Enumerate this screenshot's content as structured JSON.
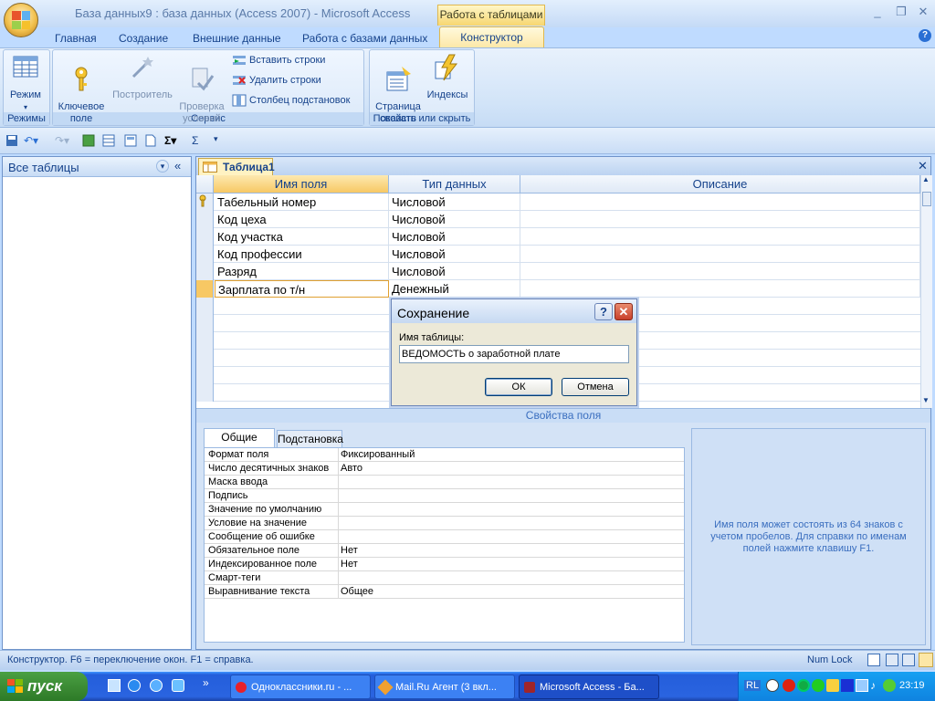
{
  "window": {
    "title": "База данных9 : база данных (Access 2007) - Microsoft Access",
    "context_tab_group": "Работа с таблицами"
  },
  "ribbon": {
    "tabs": [
      "Главная",
      "Создание",
      "Внешние данные",
      "Работа с базами данных",
      "Конструктор"
    ],
    "active_tab": "Конструктор",
    "groups": {
      "modes": {
        "label": "Режимы",
        "view_button": "Режим"
      },
      "service": {
        "label": "Сервис",
        "key_field": "Ключевое\nполе",
        "builder": "Построитель",
        "test_rules": "Проверка\nусловий",
        "insert_rows": "Вставить строки",
        "delete_rows": "Удалить строки",
        "lookup_column": "Столбец  подстановок"
      },
      "show_hide": {
        "label": "Показать или скрыть",
        "property_sheet": "Страница\nсвойств",
        "indexes": "Индексы"
      }
    }
  },
  "nav_pane": {
    "title": "Все таблицы"
  },
  "document": {
    "tab_label": "Таблица1",
    "columns": [
      "Имя поля",
      "Тип данных",
      "Описание"
    ],
    "rows": [
      {
        "name": "Табельный номер",
        "type": "Числовой",
        "key": true
      },
      {
        "name": "Код цеха",
        "type": "Числовой",
        "key": false
      },
      {
        "name": "Код участка",
        "type": "Числовой",
        "key": false
      },
      {
        "name": "Код профессии",
        "type": "Числовой",
        "key": false
      },
      {
        "name": "Разряд",
        "type": "Числовой",
        "key": false
      },
      {
        "name": "Зарплата по т/н",
        "type": "Денежный",
        "key": false
      }
    ]
  },
  "field_properties": {
    "title": "Свойства поля",
    "tabs": [
      "Общие",
      "Подстановка"
    ],
    "rows": [
      {
        "key": "Формат поля",
        "value": "Фиксированный"
      },
      {
        "key": "Число десятичных знаков",
        "value": "Авто"
      },
      {
        "key": "Маска ввода",
        "value": ""
      },
      {
        "key": "Подпись",
        "value": ""
      },
      {
        "key": "Значение по умолчанию",
        "value": ""
      },
      {
        "key": "Условие на значение",
        "value": ""
      },
      {
        "key": "Сообщение об ошибке",
        "value": ""
      },
      {
        "key": "Обязательное поле",
        "value": "Нет"
      },
      {
        "key": "Индексированное поле",
        "value": "Нет"
      },
      {
        "key": "Смарт-теги",
        "value": ""
      },
      {
        "key": "Выравнивание текста",
        "value": "Общее"
      }
    ],
    "hint": "Имя поля может состоять из 64 знаков с учетом пробелов.  Для справки по именам полей нажмите клавишу F1."
  },
  "dialog": {
    "title": "Сохранение",
    "label": "Имя таблицы:",
    "value": "ВЕДОМОСТЬ о заработной плате",
    "ok": "ОК",
    "cancel": "Отмена"
  },
  "status": {
    "text": "Конструктор.  F6 = переключение окон.  F1 = справка.",
    "numlock": "Num Lock"
  },
  "taskbar": {
    "start": "пуск",
    "tasks": [
      "Одноклассники.ru - ...",
      "Mail.Ru Агент (3 вкл...",
      "Microsoft Access - Ба..."
    ],
    "lang": "RL",
    "clock": "23:19"
  },
  "colors": {
    "accent": "#15428b",
    "ribbon_bg": "#bfdbff",
    "context_tab": "#fce7a6",
    "taskbar": "#245edb",
    "start": "#3c8c35"
  }
}
